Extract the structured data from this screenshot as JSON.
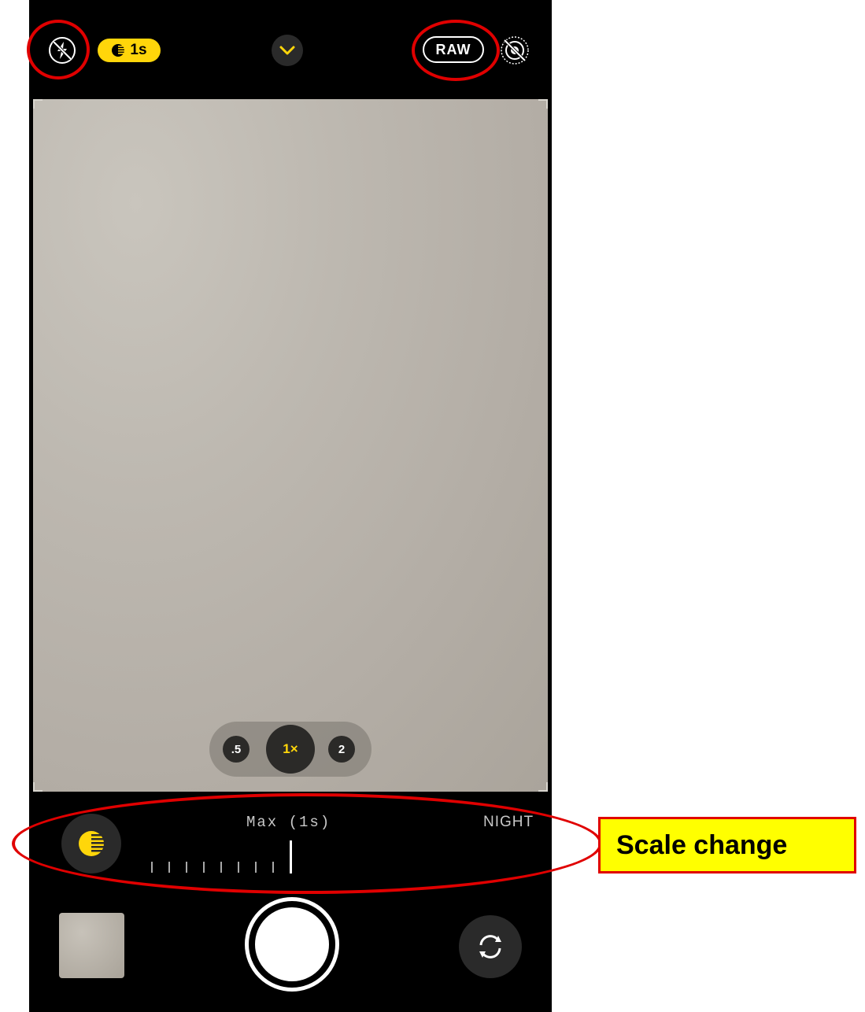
{
  "top_bar": {
    "flash_icon": "flash-off-icon",
    "night_mode_badge": "1s",
    "chevron_icon": "chevron-down-icon",
    "raw_label": "RAW",
    "live_icon": "live-photo-off-icon"
  },
  "zoom": {
    "options": [
      ".5",
      "1×",
      "2"
    ],
    "selected": "1×"
  },
  "night_slider": {
    "label": "Max (1s)",
    "mode_label": "NIGHT",
    "icon": "night-mode-icon"
  },
  "bottom_bar": {
    "thumbnail": "last-photo-thumbnail",
    "shutter": "shutter-button",
    "flip_icon": "flip-camera-icon"
  },
  "annotation": {
    "callout_text": "Scale change",
    "highlight_color": "#e00000",
    "callout_bg": "#ffff00"
  },
  "colors": {
    "accent_yellow": "#ffd60a",
    "background": "#000000"
  }
}
